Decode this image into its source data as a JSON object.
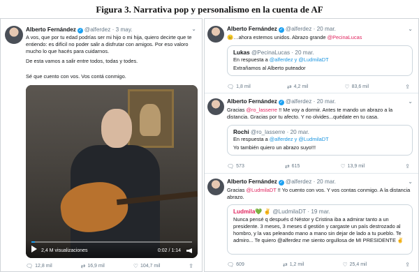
{
  "figure": {
    "title": "Figura 3. Narrativa pop y personalismo en la cuenta de AF"
  },
  "left": {
    "name": "Alberto Fernández",
    "handle": "@alferdez",
    "date": "· 3 may.",
    "p1": "A vos, que por tu edad podrías ser mi hijo o mi hija, quiero decirte que te entiendo: es difícil no poder salir a disfrutar con amigos. Por eso valoro mucho lo que hacés para cuidarnos.",
    "p2": "De esta vamos a salir entre todos, todas y todes.",
    "p3": "Sé que cuento con vos. Vos contá conmigo.",
    "video": {
      "views": "2,4 M visualizaciones",
      "time": "0:02 / 1:14",
      "progress": 0.02
    },
    "actions": {
      "replies": "12,8 mil",
      "retweets": "16,9 mil",
      "likes": "104,7 mil"
    }
  },
  "tweets": [
    {
      "name": "Alberto Fernández",
      "handle": "@alferdez",
      "date": "· 20 mar.",
      "text_pre": "…ahora estemos unidos. Abrazo grande ",
      "text_link": "@PecinaLucas",
      "text_post": "",
      "quote": {
        "name": "Lukas",
        "handle": "@PecinaLucas · 20 mar.",
        "reply_prefix": "En respuesta a ",
        "reply_to": "@alferdez y @LudmilaDT",
        "text": "Extrañamos al Alberto puteador"
      },
      "actions": {
        "replies": "1,8 mil",
        "retweets": "4,2 mil",
        "likes": "83,6 mil"
      }
    },
    {
      "name": "Alberto Fernández",
      "handle": "@alferdez",
      "date": "· 20 mar.",
      "text_pre": "Gracias ",
      "text_link": "@ro_lasserre",
      "text_post": " !! Me voy a dormir. Antes te mando un abrazo a la distancia. Gracias por tu afecto. Y no olvides...quédate en tu casa.",
      "quote": {
        "name": "Rochi",
        "handle": "@ro_lasserre · 20 mar.",
        "reply_prefix": "En respuesta a ",
        "reply_to": "@alferdez y @LudmilaDT",
        "text": "Yo también quiero un abrazo suyo!!!"
      },
      "actions": {
        "replies": "573",
        "retweets": "615",
        "likes": "13,9 mil"
      }
    },
    {
      "name": "Alberto Fernández",
      "handle": "@alferdez",
      "date": "· 20 mar.",
      "text_pre": "Gracias ",
      "text_link": "@LudmilaDT",
      "text_post": " !! Yo cuento con vos. Y vos contas conmigo. A la distancia abrazo.",
      "quote": {
        "name": "Ludmila💚 ✌",
        "handle": "@LudmilaDT · 19 mar.",
        "reply_prefix": "",
        "reply_to": "",
        "text": "Nunca pensé q después d Néstor y Cristina iba a admirar tanto a un presidente. 3 meses, 3 meses d gestión y cargaste un país destrozado al hombro, y la vas peleando mano a mano sin dejar de lado a tu pueblo. Te admiro... Te quiero @alferdez me siento orgullosa de MI PRESIDENTE ✌"
      },
      "actions": {
        "replies": "609",
        "retweets": "1,2 mil",
        "likes": "25,4 mil"
      }
    }
  ]
}
